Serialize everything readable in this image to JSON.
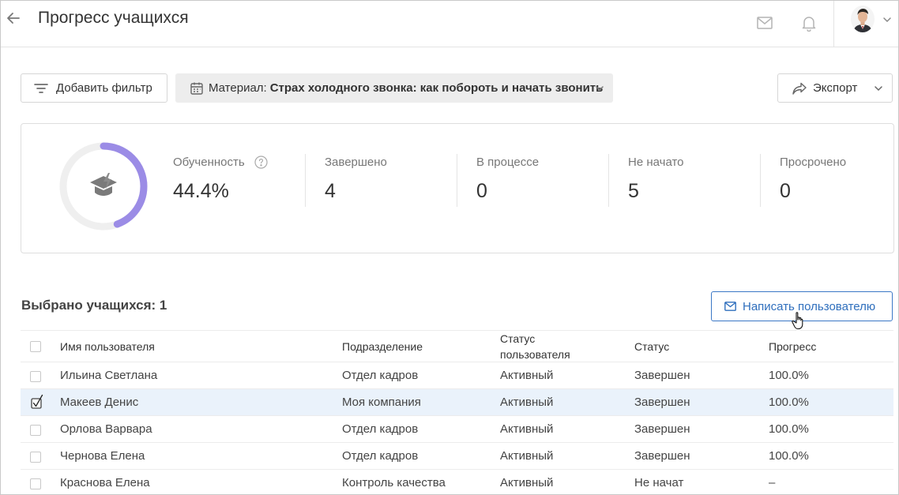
{
  "header": {
    "title": "Прогресс учащихся"
  },
  "toolbar": {
    "add_filter_label": "Добавить фильтр",
    "material_label": "Материал:",
    "material_value": "Страх холодного звонка: как побороть и начать звонить",
    "export_label": "Экспорт"
  },
  "stats": {
    "donut_progress": 0.444,
    "colors": {
      "ring_fill": "#9b8ce6",
      "ring_track": "#efefef",
      "icon": "#7a7a7a"
    },
    "items": [
      {
        "label": "Обученность",
        "value": "44.4%"
      },
      {
        "label": "Завершено",
        "value": "4"
      },
      {
        "label": "В процессе",
        "value": "0"
      },
      {
        "label": "Не начато",
        "value": "5"
      },
      {
        "label": "Просрочено",
        "value": "0"
      }
    ]
  },
  "selection": {
    "count_text": "Выбрано учащихся: 1",
    "write_button_label": "Написать пользователю"
  },
  "table": {
    "columns": {
      "name": "Имя пользователя",
      "dept": "Подразделение",
      "user_status": "Статус пользователя",
      "status": "Статус",
      "progress": "Прогресс"
    },
    "rows": [
      {
        "name": "Ильина Светлана",
        "dept": "Отдел кадров",
        "user_status": "Активный",
        "status": "Завершен",
        "progress": "100.0%",
        "checked": false
      },
      {
        "name": "Макеев Денис",
        "dept": "Моя компания",
        "user_status": "Активный",
        "status": "Завершен",
        "progress": "100.0%",
        "checked": true
      },
      {
        "name": "Орлова Варвара",
        "dept": "Отдел кадров",
        "user_status": "Активный",
        "status": "Завершен",
        "progress": "100.0%",
        "checked": false
      },
      {
        "name": "Чернова Елена",
        "dept": "Отдел кадров",
        "user_status": "Активный",
        "status": "Завершен",
        "progress": "100.0%",
        "checked": false
      },
      {
        "name": "Краснова Елена",
        "dept": "Контроль качества",
        "user_status": "Активный",
        "status": "Не начат",
        "progress": "–",
        "checked": false
      }
    ]
  },
  "accent_color": "#2f6fbd"
}
